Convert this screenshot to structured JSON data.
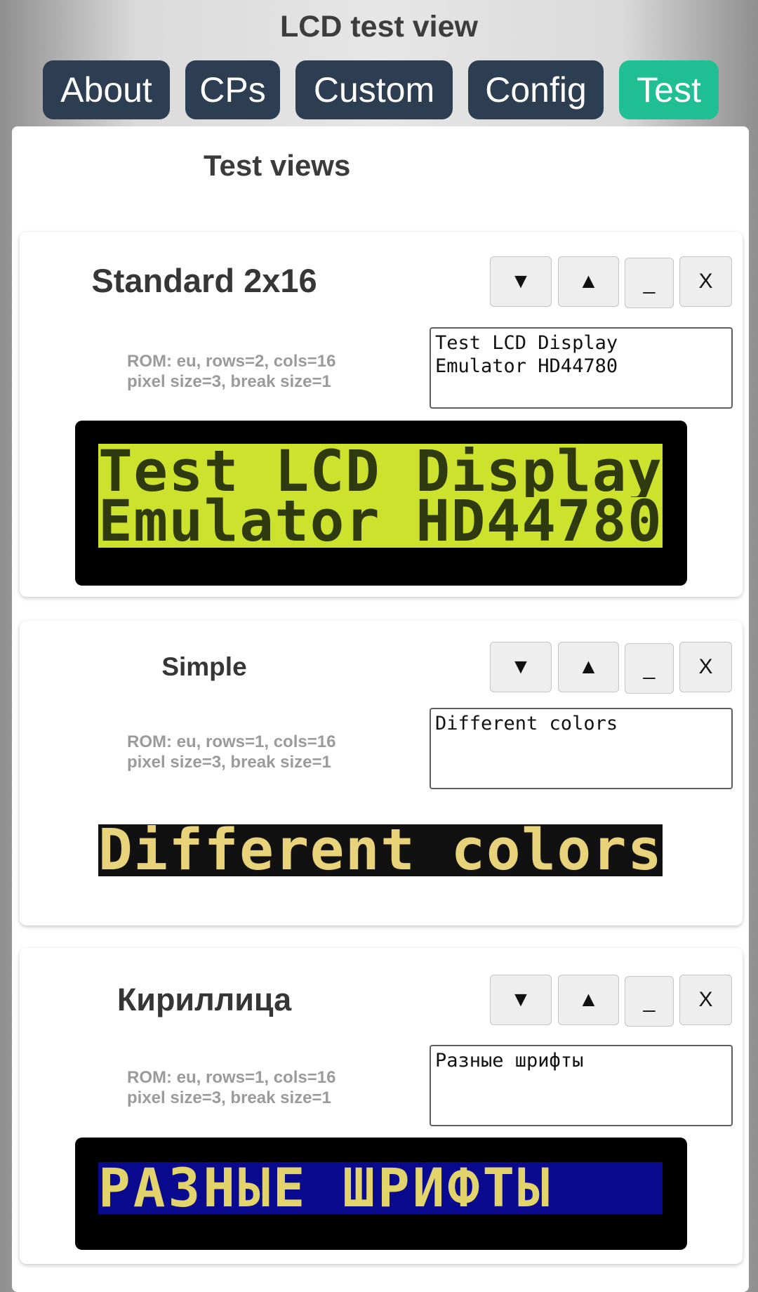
{
  "page": {
    "title": "LCD test view"
  },
  "tabs": [
    {
      "label": "About"
    },
    {
      "label": "CPs"
    },
    {
      "label": "Custom"
    },
    {
      "label": "Config"
    },
    {
      "label": "Test",
      "active": true
    }
  ],
  "section": {
    "title": "Test views"
  },
  "controls": {
    "down": "▼",
    "up": "▲",
    "minimize": "_",
    "close": "X"
  },
  "cards": [
    {
      "title": "Standard 2x16",
      "meta_line1": "ROM: eu, rows=2, cols=16",
      "meta_line2": "pixel size=3, break size=1",
      "input_value": "Test LCD Display\nEmulator HD44780",
      "lcd_lines": [
        "Test LCD Display",
        "Emulator HD44780"
      ],
      "colors": {
        "background": "#cde22c",
        "text": "#2f3a10",
        "bezel": "#000000"
      }
    },
    {
      "title": "Simple",
      "meta_line1": "ROM: eu, rows=1, cols=16",
      "meta_line2": "pixel size=3, break size=1",
      "input_value": "Different colors",
      "lcd_lines": [
        "Different colors"
      ],
      "colors": {
        "background": "#111111",
        "text": "#e8d27a"
      }
    },
    {
      "title": "Кириллица",
      "meta_line1": "ROM: eu, rows=1, cols=16",
      "meta_line2": "pixel size=3, break size=1",
      "input_value": "Разные шрифты",
      "lcd_lines": [
        "РАЗНЫЕ ШРИФТЫ"
      ],
      "colors": {
        "background": "#0a0a8e",
        "text": "#e2d36a",
        "bezel": "#000000"
      }
    }
  ]
}
